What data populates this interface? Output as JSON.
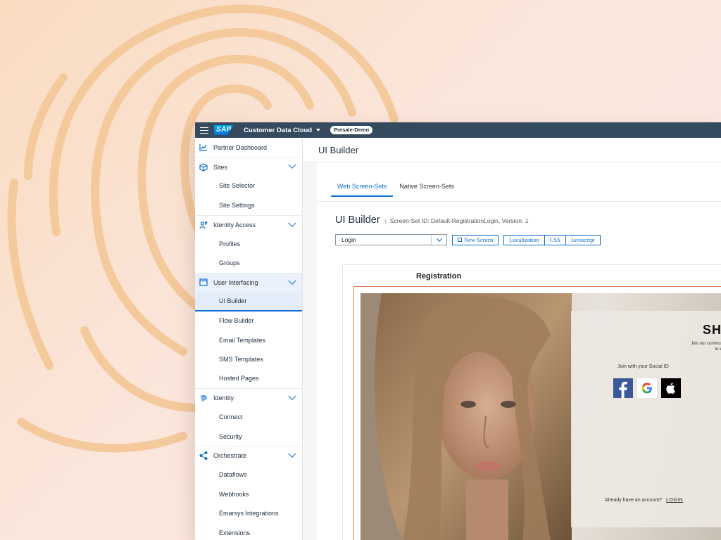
{
  "topbar": {
    "brand": "SAP",
    "product": "Customer Data Cloud",
    "tenant": "Presale-Demo"
  },
  "sidebar": {
    "items": [
      {
        "label": "Partner Dashboard",
        "type": "group",
        "icon": "chart-icon"
      },
      {
        "label": "Sites",
        "type": "group",
        "icon": "cube-icon",
        "expandable": true
      },
      {
        "label": "Site Selector",
        "type": "sub"
      },
      {
        "label": "Site Settings",
        "type": "sub"
      },
      {
        "label": "Identity Access",
        "type": "group",
        "icon": "user-key-icon",
        "expandable": true
      },
      {
        "label": "Profiles",
        "type": "sub"
      },
      {
        "label": "Groups",
        "type": "sub"
      },
      {
        "label": "User Interfacing",
        "type": "group",
        "icon": "window-icon",
        "expandable": true,
        "expanded": true
      },
      {
        "label": "UI Builder",
        "type": "sub",
        "active": true
      },
      {
        "label": "Flow Builder",
        "type": "sub"
      },
      {
        "label": "Email Templates",
        "type": "sub"
      },
      {
        "label": "SMS Templates",
        "type": "sub"
      },
      {
        "label": "Hosted Pages",
        "type": "sub"
      },
      {
        "label": "Identity",
        "type": "group",
        "icon": "fingerprint-icon",
        "expandable": true
      },
      {
        "label": "Connect",
        "type": "sub"
      },
      {
        "label": "Security",
        "type": "sub"
      },
      {
        "label": "Orchestrate",
        "type": "group",
        "icon": "share-nodes-icon",
        "expandable": true
      },
      {
        "label": "Dataflows",
        "type": "sub"
      },
      {
        "label": "Webhooks",
        "type": "sub"
      },
      {
        "label": "Emarsys Integrations",
        "type": "sub"
      },
      {
        "label": "Extensions",
        "type": "sub"
      }
    ]
  },
  "header": {
    "title": "UI Builder"
  },
  "tabs": [
    {
      "label": "Web Screen-Sets",
      "active": true
    },
    {
      "label": "Native Screen-Sets",
      "active": false
    }
  ],
  "builder": {
    "title": "UI Builder",
    "meta": "Screen-Set ID: Default-RegistrationLogin,  Version: 1",
    "screen_select": "Login",
    "new_screen": "New Screen",
    "tool_buttons": [
      "Localization",
      "CSS",
      "Javascript"
    ]
  },
  "preview": {
    "title": "Registration",
    "brand": "SHE",
    "tagline": "Join our community\nto worl",
    "social_label": "Join with your Social ID",
    "social": [
      "facebook-icon",
      "google-icon",
      "apple-icon"
    ],
    "login_prompt": "Already have an account?",
    "login_link": "LOGIN"
  },
  "colors": {
    "topbar": "#354a5f",
    "accent": "#0a6ed1",
    "outline": "#e07a4f",
    "background": "#f9dcc0"
  }
}
